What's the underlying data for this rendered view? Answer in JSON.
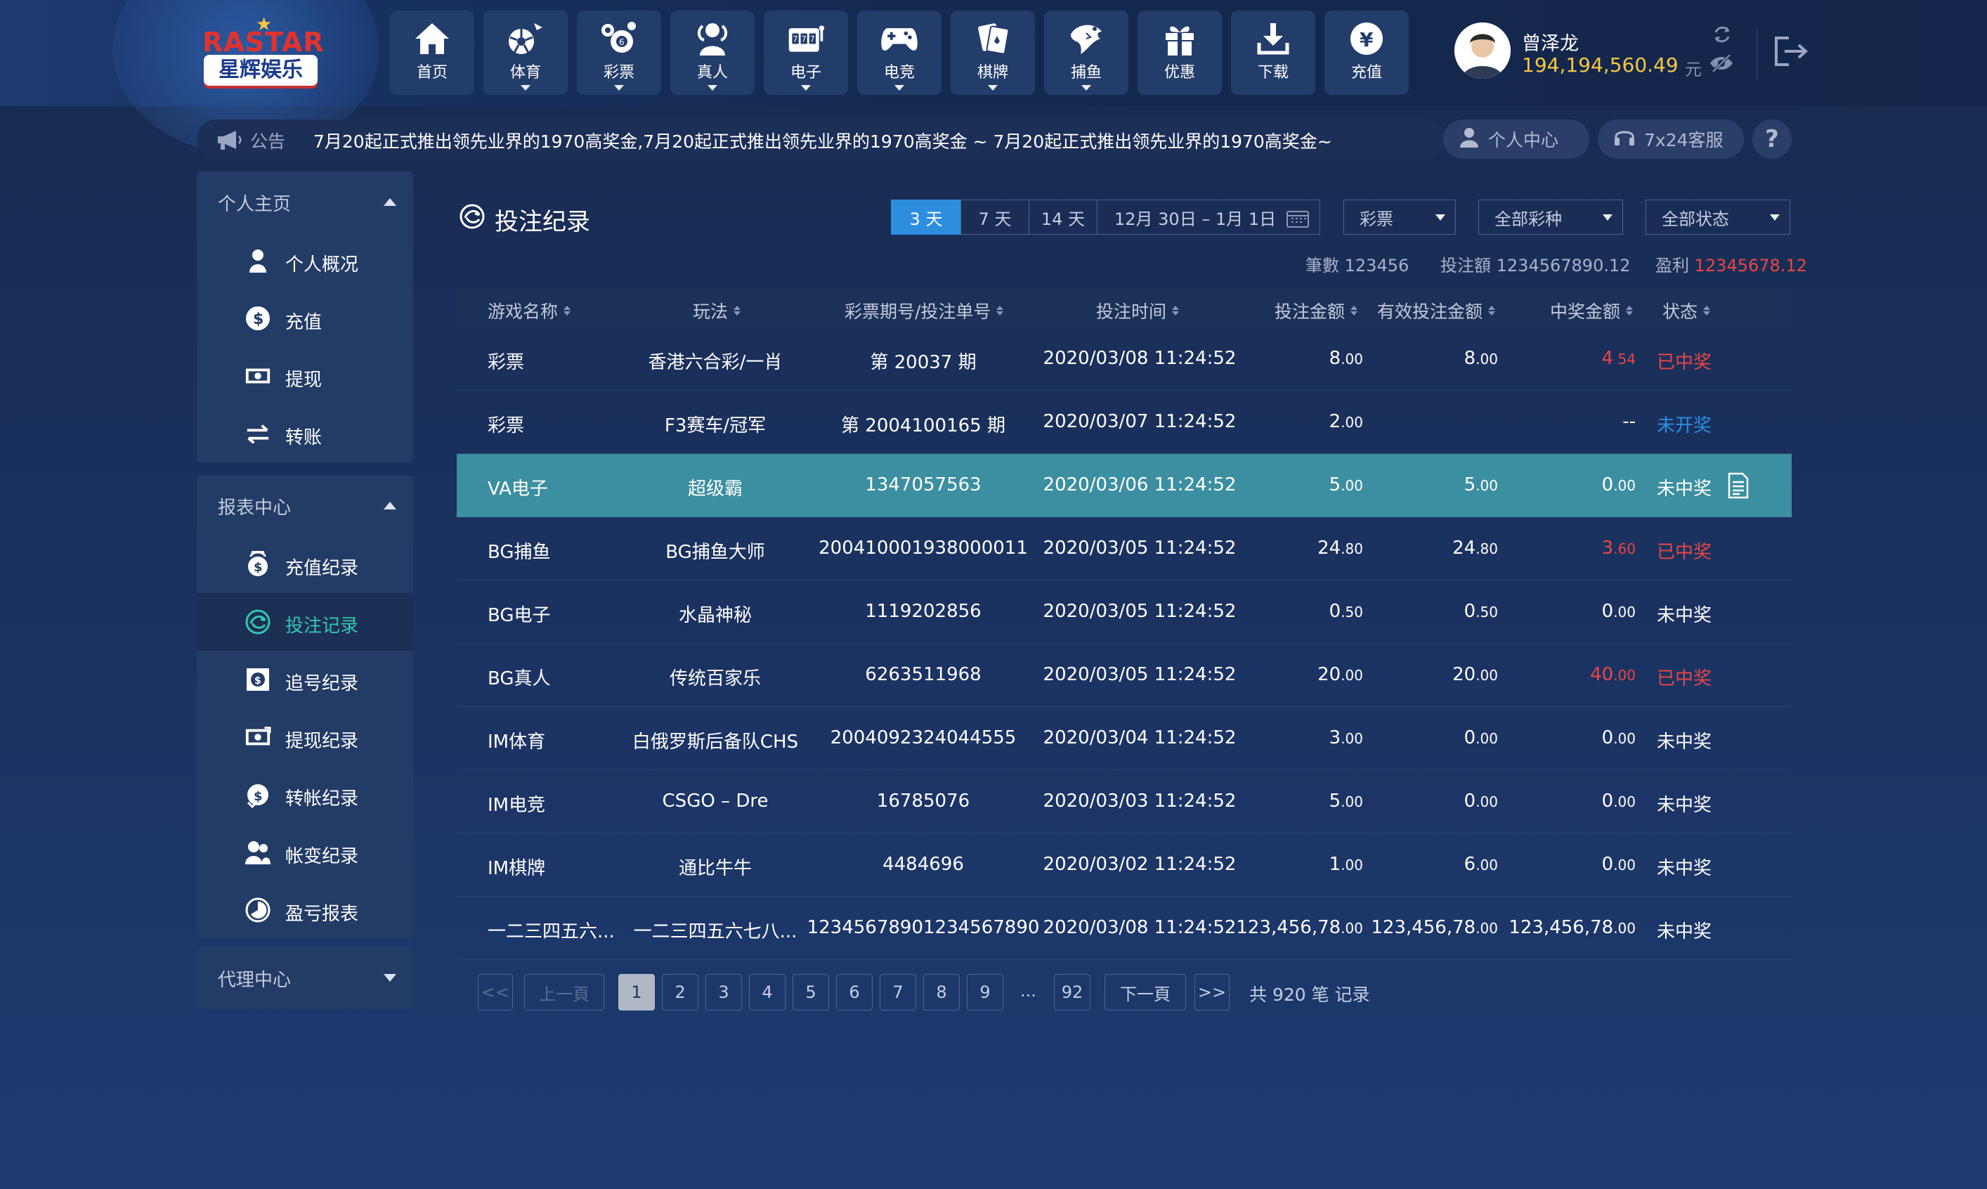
{
  "brand": {
    "name_en": "RASTAR",
    "name_cn": "星辉娱乐"
  },
  "nav": [
    {
      "label": "首页",
      "icon": "home-icon",
      "dropdown": false
    },
    {
      "label": "体育",
      "icon": "sports-ball-icon",
      "dropdown": true
    },
    {
      "label": "彩票",
      "icon": "lottery-balls-icon",
      "dropdown": true
    },
    {
      "label": "真人",
      "icon": "live-dealer-icon",
      "dropdown": true
    },
    {
      "label": "电子",
      "icon": "slot-machine-icon",
      "dropdown": true
    },
    {
      "label": "电竞",
      "icon": "gamepad-icon",
      "dropdown": true
    },
    {
      "label": "棋牌",
      "icon": "cards-icon",
      "dropdown": true
    },
    {
      "label": "捕鱼",
      "icon": "fish-icon",
      "dropdown": true
    },
    {
      "label": "优惠",
      "icon": "gift-icon",
      "dropdown": false
    },
    {
      "label": "下载",
      "icon": "download-icon",
      "dropdown": false
    },
    {
      "label": "充值",
      "icon": "yuan-coin-icon",
      "dropdown": false
    }
  ],
  "user": {
    "name": "曾泽龙",
    "balance": "194,194,560.49",
    "currency": "元"
  },
  "notice": {
    "label": "公告",
    "text": "7月20起正式推出领先业界的1970高奖金,7月20起正式推出领先业界的1970高奖金 ~ 7月20起正式推出领先业界的1970高奖金~"
  },
  "header_buttons": {
    "personal_center": "个人中心",
    "support": "7x24客服",
    "help": "?"
  },
  "sidebar": {
    "sections": [
      {
        "title": "个人主页",
        "expanded": true,
        "items": [
          {
            "label": "个人概况",
            "icon": "user-icon"
          },
          {
            "label": "充值",
            "icon": "dollar-circle-icon"
          },
          {
            "label": "提现",
            "icon": "cash-icon"
          },
          {
            "label": "转账",
            "icon": "transfer-arrows-icon"
          }
        ]
      },
      {
        "title": "报表中心",
        "expanded": true,
        "items": [
          {
            "label": "充值纪录",
            "icon": "coins-stack-icon"
          },
          {
            "label": "投注记录",
            "icon": "bet-chip-icon",
            "active": true
          },
          {
            "label": "追号纪录",
            "icon": "chase-number-icon"
          },
          {
            "label": "提现纪录",
            "icon": "withdraw-record-icon"
          },
          {
            "label": "转帐纪录",
            "icon": "transfer-coin-icon"
          },
          {
            "label": "帐变纪录",
            "icon": "users-icon"
          },
          {
            "label": "盈亏报表",
            "icon": "pie-chart-icon"
          }
        ]
      },
      {
        "title": "代理中心",
        "expanded": false,
        "items": []
      }
    ]
  },
  "main": {
    "title": "投注纪录",
    "range_tabs": [
      "3 天",
      "7 天",
      "14 天"
    ],
    "active_range": 0,
    "date_range": "12月 30日 – 1月 1日",
    "filters": {
      "category": "彩票",
      "lottery": "全部彩种",
      "status": "全部状态"
    },
    "summary": {
      "count_label": "筆數",
      "count": "123456",
      "bet_label": "投注額",
      "bet": "1234567890.12",
      "profit_label": "盈利",
      "profit": "12345678.12"
    },
    "columns": [
      "游戏名称",
      "玩法",
      "彩票期号/投注单号",
      "投注时间",
      "投注金额",
      "有效投注金额",
      "中奖金额",
      "状态"
    ],
    "rows": [
      {
        "game": "彩票",
        "play": "香港六合彩/一肖",
        "id": "第 20037 期",
        "time": "2020/03/08 11:24:52",
        "bet_int": "8",
        "bet_dec": ".00",
        "valid_int": "8",
        "valid_dec": ".00",
        "win_int": "4",
        "win_dec": " 54",
        "win_color": "red",
        "status": "已中奖",
        "status_color": "red"
      },
      {
        "game": "彩票",
        "play": "F3赛车/冠军",
        "id": "第 2004100165 期",
        "time": "2020/03/07 11:24:52",
        "bet_int": "2",
        "bet_dec": ".00",
        "valid_int": "",
        "valid_dec": "",
        "win_int": "--",
        "win_dec": "",
        "win_color": "white",
        "status": "未开奖",
        "status_color": "blue"
      },
      {
        "game": "VA电子",
        "play": "超级霸",
        "id": "1347057563",
        "time": "2020/03/06 11:24:52",
        "bet_int": "5",
        "bet_dec": ".00",
        "valid_int": "5",
        "valid_dec": ".00",
        "win_int": "0",
        "win_dec": ".00",
        "win_color": "white",
        "status": "未中奖",
        "status_color": "white",
        "highlight": true
      },
      {
        "game": "BG捕鱼",
        "play": "BG捕鱼大师",
        "id": "200410001938000011",
        "time": "2020/03/05 11:24:52",
        "bet_int": "24",
        "bet_dec": ".80",
        "valid_int": "24",
        "valid_dec": ".80",
        "win_int": "3",
        "win_dec": ".60",
        "win_color": "red",
        "status": "已中奖",
        "status_color": "red"
      },
      {
        "game": "BG电子",
        "play": "水晶神秘",
        "id": "1119202856",
        "time": "2020/03/05 11:24:52",
        "bet_int": "0",
        "bet_dec": ".50",
        "valid_int": "0",
        "valid_dec": ".50",
        "win_int": "0",
        "win_dec": ".00",
        "win_color": "white",
        "status": "未中奖",
        "status_color": "white"
      },
      {
        "game": "BG真人",
        "play": "传统百家乐",
        "id": "6263511968",
        "time": "2020/03/05 11:24:52",
        "bet_int": "20",
        "bet_dec": ".00",
        "valid_int": "20",
        "valid_dec": ".00",
        "win_int": "40",
        "win_dec": ".00",
        "win_color": "red",
        "status": "已中奖",
        "status_color": "red"
      },
      {
        "game": "IM体育",
        "play": "白俄罗斯后备队CHS",
        "id": "2004092324044555",
        "time": "2020/03/04 11:24:52",
        "bet_int": "3",
        "bet_dec": ".00",
        "valid_int": "0",
        "valid_dec": ".00",
        "win_int": "0",
        "win_dec": ".00",
        "win_color": "white",
        "status": "未中奖",
        "status_color": "white"
      },
      {
        "game": "IM电竞",
        "play": "CSGO – Dre",
        "id": "16785076",
        "time": "2020/03/03 11:24:52",
        "bet_int": "5",
        "bet_dec": ".00",
        "valid_int": "0",
        "valid_dec": ".00",
        "win_int": "0",
        "win_dec": ".00",
        "win_color": "white",
        "status": "未中奖",
        "status_color": "white"
      },
      {
        "game": "IM棋牌",
        "play": "通比牛牛",
        "id": "4484696",
        "time": "2020/03/02 11:24:52",
        "bet_int": "1",
        "bet_dec": ".00",
        "valid_int": "6",
        "valid_dec": ".00",
        "win_int": "0",
        "win_dec": ".00",
        "win_color": "white",
        "status": "未中奖",
        "status_color": "white"
      },
      {
        "game": "一二三四五六...",
        "play": "一二三四五六七八...",
        "id": "12345678901234567890",
        "time": "2020/03/08 11:24:52",
        "bet_int": "123,456,78",
        "bet_dec": ".00",
        "valid_int": "123,456,78",
        "valid_dec": ".00",
        "win_int": "123,456,78",
        "win_dec": ".00",
        "win_color": "white",
        "status": "未中奖",
        "status_color": "white"
      }
    ],
    "pagination": {
      "first": "<<",
      "prev": "上一頁",
      "pages": [
        "1",
        "2",
        "3",
        "4",
        "5",
        "6",
        "7",
        "8",
        "9"
      ],
      "ellipsis": "...",
      "last_page": "92",
      "next": "下一頁",
      "end": ">>",
      "current": "1",
      "total_text": "共 920 笔 记录"
    }
  },
  "colors": {
    "accent_blue": "#2d8ee0",
    "win_red": "#e84646",
    "active_teal": "#34c6b1",
    "highlight_row": "#3c8fa0",
    "balance_gold": "#f5c842"
  }
}
